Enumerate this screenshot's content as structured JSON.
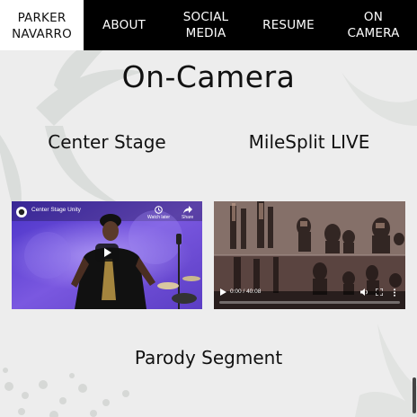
{
  "nav": {
    "brand_line1": "PARKER",
    "brand_line2": "NAVARRO",
    "items": [
      {
        "line1": "ABOUT",
        "line2": ""
      },
      {
        "line1": "SOCIAL",
        "line2": "MEDIA"
      },
      {
        "line1": "RESUME",
        "line2": ""
      },
      {
        "line1": "ON",
        "line2": "CAMERA"
      }
    ]
  },
  "page": {
    "title": "On-Camera"
  },
  "videos": [
    {
      "heading": "Center Stage",
      "player_title": "Center Stage Unity",
      "watch_later": "Watch later",
      "share": "Share"
    },
    {
      "heading": "MileSplit LIVE",
      "time": "0:00 / 40:08",
      "progress": 0
    }
  ],
  "next_section": {
    "title": "Parody Segment"
  },
  "colors": {
    "nav_bg": "#000000",
    "page_bg": "#ededed",
    "stage_purple": "#6a4fd6"
  }
}
